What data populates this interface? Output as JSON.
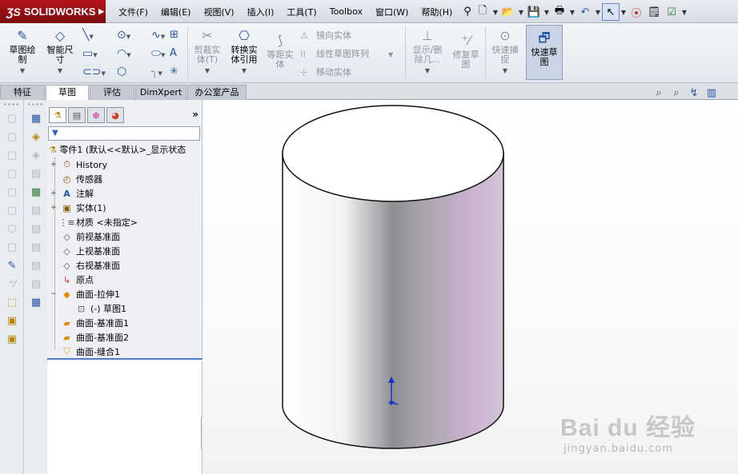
{
  "app": {
    "brand_ds": "ƷS",
    "brand": "SOLIDWORKS",
    "brand_menu_arrow": "▶"
  },
  "menu": [
    "文件(F)",
    "编辑(E)",
    "视图(V)",
    "插入(I)",
    "工具(T)",
    "Toolbox",
    "窗口(W)",
    "帮助(H)"
  ],
  "quick_access": {
    "icons": [
      "new-document-icon",
      "open-folder-icon",
      "save-icon",
      "print-icon",
      "undo-icon",
      "select-arrow-icon",
      "rebuild-traffic-light-icon",
      "file-properties-icon",
      "options-icon"
    ]
  },
  "ribbon": {
    "sketch": "草图绘\n制",
    "smart_dim": "智能尺\n寸",
    "trim": "剪裁实\n体(T)",
    "convert": "转换实\n体引用",
    "offset": "等距实\n体",
    "mirror": "镜向实体",
    "linear_pattern": "线性草图阵列",
    "move": "移动实体",
    "show_delete": "显示/删\n除几...",
    "repair": "修复草\n图",
    "quick_snap": "快速捕\n捉",
    "quick_sketch": "快速草\n图"
  },
  "tabs": [
    "特征",
    "草图",
    "评估",
    "DimXpert",
    "办公室产品"
  ],
  "active_tab": "草图",
  "tree": {
    "expand_glyph": "»",
    "filter_glyph": "▼",
    "root": "零件1  (默认<<默认>_显示状态",
    "items": [
      {
        "label": "History",
        "icon": "history-icon",
        "expand": "+"
      },
      {
        "label": "传感器",
        "icon": "sensor-icon",
        "expand": ""
      },
      {
        "label": "注解",
        "icon": "annotation-icon",
        "expand": "+"
      },
      {
        "label": "实体(1)",
        "icon": "solid-bodies-icon",
        "expand": "+"
      },
      {
        "label": "材质 <未指定>",
        "icon": "material-icon",
        "expand": ""
      },
      {
        "label": "前视基准面",
        "icon": "plane-icon",
        "expand": ""
      },
      {
        "label": "上视基准面",
        "icon": "plane-icon",
        "expand": ""
      },
      {
        "label": "右视基准面",
        "icon": "plane-icon",
        "expand": ""
      },
      {
        "label": "原点",
        "icon": "origin-icon",
        "expand": ""
      },
      {
        "label": "曲面-拉伸1",
        "icon": "surface-extrude-icon",
        "expand": "−"
      },
      {
        "label": "(-) 草图1",
        "icon": "sketch-icon",
        "expand": ""
      },
      {
        "label": "曲面-基准面1",
        "icon": "planar-surface-icon",
        "expand": ""
      },
      {
        "label": "曲面-基准面2",
        "icon": "planar-surface-icon",
        "expand": ""
      },
      {
        "label": "曲面-缝合1",
        "icon": "knit-surface-icon",
        "expand": ""
      }
    ]
  },
  "watermark": {
    "main": "Bai du 经验",
    "sub": "jingyan.baidu.com"
  }
}
